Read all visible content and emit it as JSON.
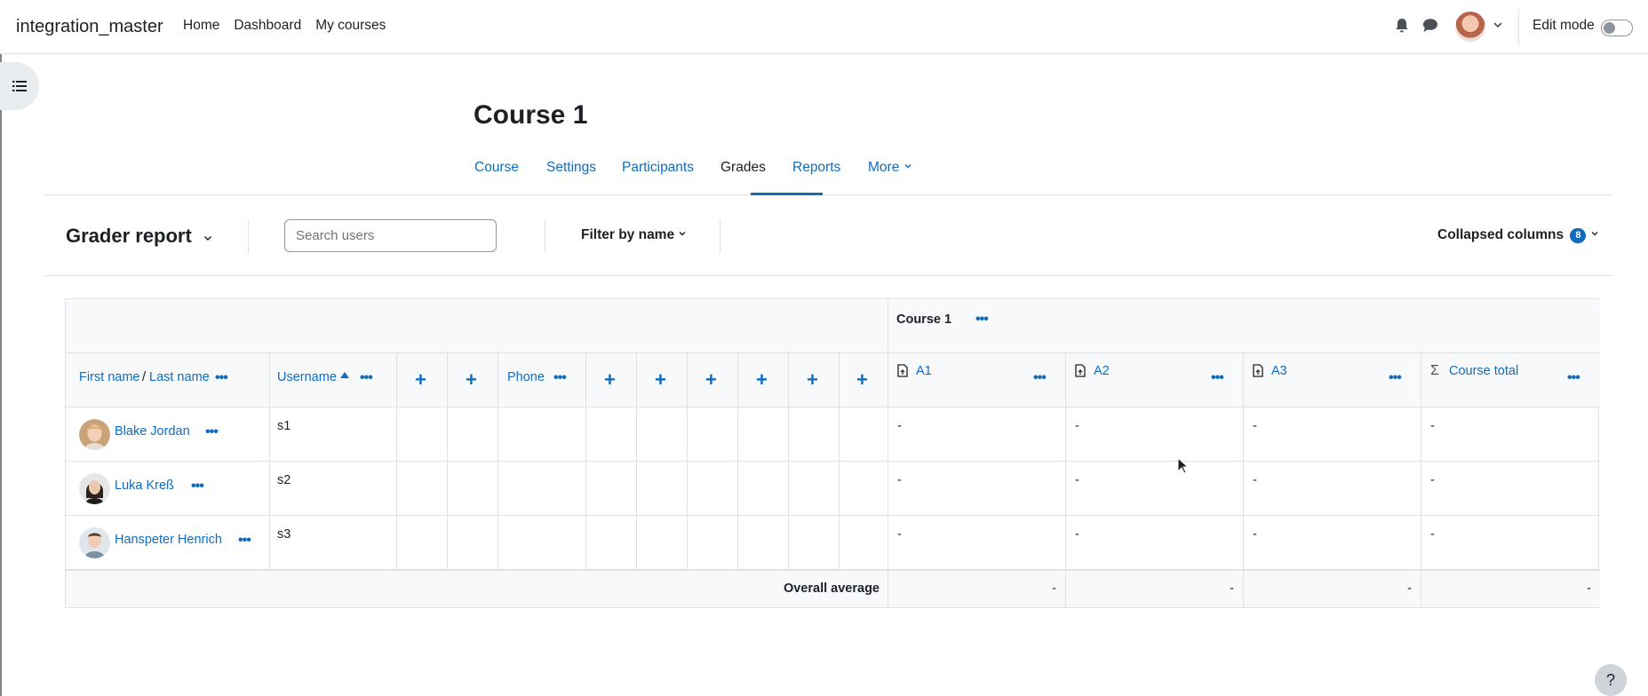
{
  "navbar": {
    "site_name": "integration_master",
    "links": [
      "Home",
      "Dashboard",
      "My courses"
    ],
    "edit_mode_label": "Edit mode",
    "edit_mode_on": false
  },
  "course": {
    "title": "Course 1",
    "tabs": [
      "Course",
      "Settings",
      "Participants",
      "Grades",
      "Reports",
      "More"
    ],
    "active_tab": "Grades"
  },
  "report": {
    "title": "Grader report",
    "search_placeholder": "Search users",
    "filter_label": "Filter by name",
    "collapsed_label": "Collapsed columns",
    "collapsed_count": "8"
  },
  "grades": {
    "category_name": "Course 1",
    "columns": {
      "firstname": "First name",
      "slash": "/",
      "lastname": "Last name",
      "username": "Username",
      "phone": "Phone",
      "items": [
        "A1",
        "A2",
        "A3",
        "Course total"
      ]
    },
    "rows": [
      {
        "name": "Blake Jordan",
        "username": "s1",
        "grades": [
          "-",
          "-",
          "-",
          "-"
        ]
      },
      {
        "name": "Luka Kreß",
        "username": "s2",
        "grades": [
          "-",
          "-",
          "-",
          "-"
        ]
      },
      {
        "name": "Hanspeter Henrich",
        "username": "s3",
        "grades": [
          "-",
          "-",
          "-",
          "-"
        ]
      }
    ],
    "overall_label": "Overall average",
    "overall": [
      "-",
      "-",
      "-",
      "-"
    ]
  },
  "help_label": "?",
  "colors": {
    "link": "#0f6cbf",
    "text": "#1d2125",
    "border": "#dee2e6",
    "shade": "#f8f9fa"
  }
}
